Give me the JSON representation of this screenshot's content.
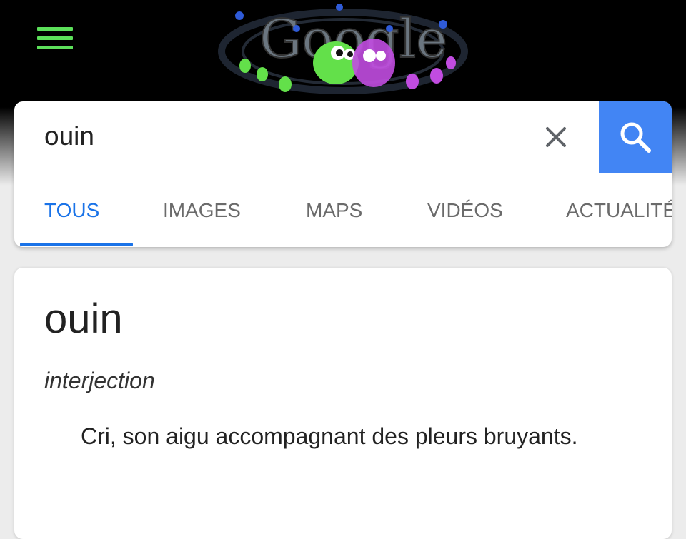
{
  "doodle": {
    "icon": "google-halloween-doodle-icon",
    "text": "Google"
  },
  "menu": {
    "icon": "hamburger-menu-icon",
    "color": "#5ce05a"
  },
  "search": {
    "value": "ouin",
    "clear_icon": "close-icon",
    "search_icon": "search-icon",
    "button_color": "#4285f4"
  },
  "tabs": [
    {
      "label": "TOUS",
      "active": true
    },
    {
      "label": "IMAGES",
      "active": false
    },
    {
      "label": "MAPS",
      "active": false
    },
    {
      "label": "VIDÉOS",
      "active": false
    },
    {
      "label": "ACTUALITÉS",
      "active": false
    }
  ],
  "result": {
    "word": "ouin",
    "part_of_speech": "interjection",
    "definition": "Cri, son aigu accompagnant des pleurs bruyants."
  },
  "colors": {
    "accent": "#1a73e8",
    "header_bg": "#000000"
  }
}
